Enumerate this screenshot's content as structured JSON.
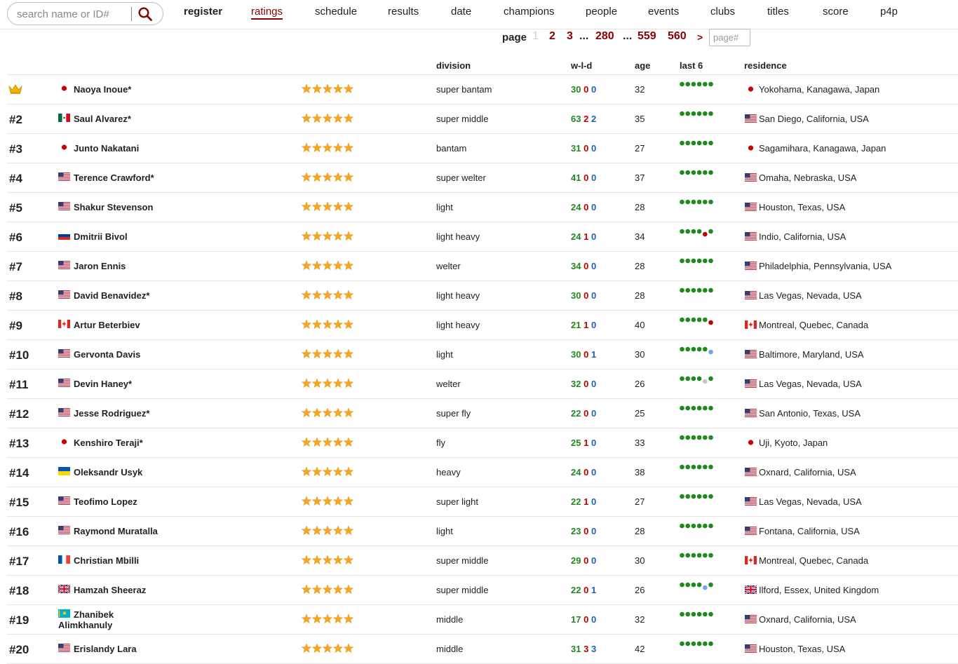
{
  "search": {
    "placeholder": "search name or ID#"
  },
  "nav": [
    "register",
    "ratings",
    "schedule",
    "results",
    "date",
    "champions",
    "people",
    "events",
    "clubs",
    "titles",
    "score",
    "p4p"
  ],
  "pagination": {
    "label": "page",
    "current": "1",
    "links": [
      "2",
      "3",
      "280",
      "559",
      "560"
    ],
    "ellipsis": "...",
    "next": ">",
    "input_placeholder": "page#"
  },
  "columns": {
    "division": "division",
    "wld": "w-l-d",
    "age": "age",
    "last6": "last 6",
    "residence": "residence"
  },
  "colors": {
    "accent": "#8b0000",
    "win": "#1e8a1e",
    "loss": "#c00000",
    "draw": "#1f5fbf",
    "star": "#f5a623"
  },
  "rows": [
    {
      "rank": "",
      "crown": true,
      "flag": "jp",
      "name": "Naoya Inoue*",
      "division": "super bantam",
      "w": "30",
      "l": "0",
      "d": "0",
      "age": "32",
      "last6": "WWWWWW",
      "rflag": "jp",
      "residence": "Yokohama, Kanagawa, Japan"
    },
    {
      "rank": "#2",
      "flag": "mx",
      "name": "Saul Alvarez*",
      "division": "super middle",
      "w": "63",
      "l": "2",
      "d": "2",
      "age": "35",
      "last6": "WWWWWW",
      "rflag": "us",
      "residence": "San Diego, California, USA"
    },
    {
      "rank": "#3",
      "flag": "jp",
      "name": "Junto Nakatani",
      "division": "bantam",
      "w": "31",
      "l": "0",
      "d": "0",
      "age": "27",
      "last6": "WWWWWW",
      "rflag": "jp",
      "residence": "Sagamihara, Kanagawa, Japan"
    },
    {
      "rank": "#4",
      "flag": "us",
      "name": "Terence Crawford*",
      "division": "super welter",
      "w": "41",
      "l": "0",
      "d": "0",
      "age": "37",
      "last6": "WWWWWW",
      "rflag": "us",
      "residence": "Omaha, Nebraska, USA"
    },
    {
      "rank": "#5",
      "flag": "us",
      "name": "Shakur Stevenson",
      "division": "light",
      "w": "24",
      "l": "0",
      "d": "0",
      "age": "28",
      "last6": "WWWWWW",
      "rflag": "us",
      "residence": "Houston, Texas, USA"
    },
    {
      "rank": "#6",
      "flag": "ru",
      "name": "Dmitrii Bivol",
      "division": "light heavy",
      "w": "24",
      "l": "1",
      "d": "0",
      "age": "34",
      "last6": "WWWWLW",
      "rflag": "us",
      "residence": "Indio, California, USA"
    },
    {
      "rank": "#7",
      "flag": "us",
      "name": "Jaron Ennis",
      "division": "welter",
      "w": "34",
      "l": "0",
      "d": "0",
      "age": "28",
      "last6": "WWWWWW",
      "rflag": "us",
      "residence": "Philadelphia, Pennsylvania, USA"
    },
    {
      "rank": "#8",
      "flag": "us",
      "name": "David Benavidez*",
      "division": "light heavy",
      "w": "30",
      "l": "0",
      "d": "0",
      "age": "28",
      "last6": "WWWWWW",
      "rflag": "us",
      "residence": "Las Vegas, Nevada, USA"
    },
    {
      "rank": "#9",
      "flag": "ca",
      "name": "Artur Beterbiev",
      "division": "light heavy",
      "w": "21",
      "l": "1",
      "d": "0",
      "age": "40",
      "last6": "WWWWWL",
      "rflag": "ca",
      "residence": "Montreal, Quebec, Canada"
    },
    {
      "rank": "#10",
      "flag": "us",
      "name": "Gervonta Davis",
      "division": "light",
      "w": "30",
      "l": "0",
      "d": "1",
      "age": "30",
      "last6": "WWWWWD",
      "rflag": "us",
      "residence": "Baltimore, Maryland, USA"
    },
    {
      "rank": "#11",
      "flag": "us",
      "name": "Devin Haney*",
      "division": "welter",
      "w": "32",
      "l": "0",
      "d": "0",
      "age": "26",
      "last6": "WWWWNW",
      "rflag": "us",
      "residence": "Las Vegas, Nevada, USA"
    },
    {
      "rank": "#12",
      "flag": "us",
      "name": "Jesse Rodriguez*",
      "division": "super fly",
      "w": "22",
      "l": "0",
      "d": "0",
      "age": "25",
      "last6": "WWWWWW",
      "rflag": "us",
      "residence": "San Antonio, Texas, USA"
    },
    {
      "rank": "#13",
      "flag": "jp",
      "name": "Kenshiro Teraji*",
      "division": "fly",
      "w": "25",
      "l": "1",
      "d": "0",
      "age": "33",
      "last6": "WWWWWW",
      "rflag": "jp",
      "residence": "Uji, Kyoto, Japan"
    },
    {
      "rank": "#14",
      "flag": "ua",
      "name": "Oleksandr Usyk",
      "division": "heavy",
      "w": "24",
      "l": "0",
      "d": "0",
      "age": "38",
      "last6": "WWWWWW",
      "rflag": "us",
      "residence": "Oxnard, California, USA"
    },
    {
      "rank": "#15",
      "flag": "us",
      "name": "Teofimo Lopez",
      "division": "super light",
      "w": "22",
      "l": "1",
      "d": "0",
      "age": "27",
      "last6": "WWWWWW",
      "rflag": "us",
      "residence": "Las Vegas, Nevada, USA"
    },
    {
      "rank": "#16",
      "flag": "us",
      "name": "Raymond Muratalla",
      "division": "light",
      "w": "23",
      "l": "0",
      "d": "0",
      "age": "28",
      "last6": "WWWWWW",
      "rflag": "us",
      "residence": "Fontana, California, USA"
    },
    {
      "rank": "#17",
      "flag": "fr",
      "name": "Christian Mbilli",
      "division": "super middle",
      "w": "29",
      "l": "0",
      "d": "0",
      "age": "30",
      "last6": "WWWWWW",
      "rflag": "ca",
      "residence": "Montreal, Quebec, Canada"
    },
    {
      "rank": "#18",
      "flag": "gb",
      "name": "Hamzah Sheeraz",
      "division": "super middle",
      "w": "22",
      "l": "0",
      "d": "1",
      "age": "26",
      "last6": "WWWWDW",
      "rflag": "gb",
      "residence": "Ilford, Essex, United Kingdom"
    },
    {
      "rank": "#19",
      "flag": "kz",
      "name": "Zhanibek Alimkhanuly",
      "division": "middle",
      "w": "17",
      "l": "0",
      "d": "0",
      "age": "32",
      "last6": "WWWWWW",
      "rflag": "us",
      "residence": "Oxnard, California, USA"
    },
    {
      "rank": "#20",
      "flag": "us",
      "name": "Erislandy Lara",
      "division": "middle",
      "w": "31",
      "l": "3",
      "d": "3",
      "age": "42",
      "last6": "WWWWWW",
      "rflag": "us",
      "residence": "Houston, Texas, USA"
    }
  ]
}
